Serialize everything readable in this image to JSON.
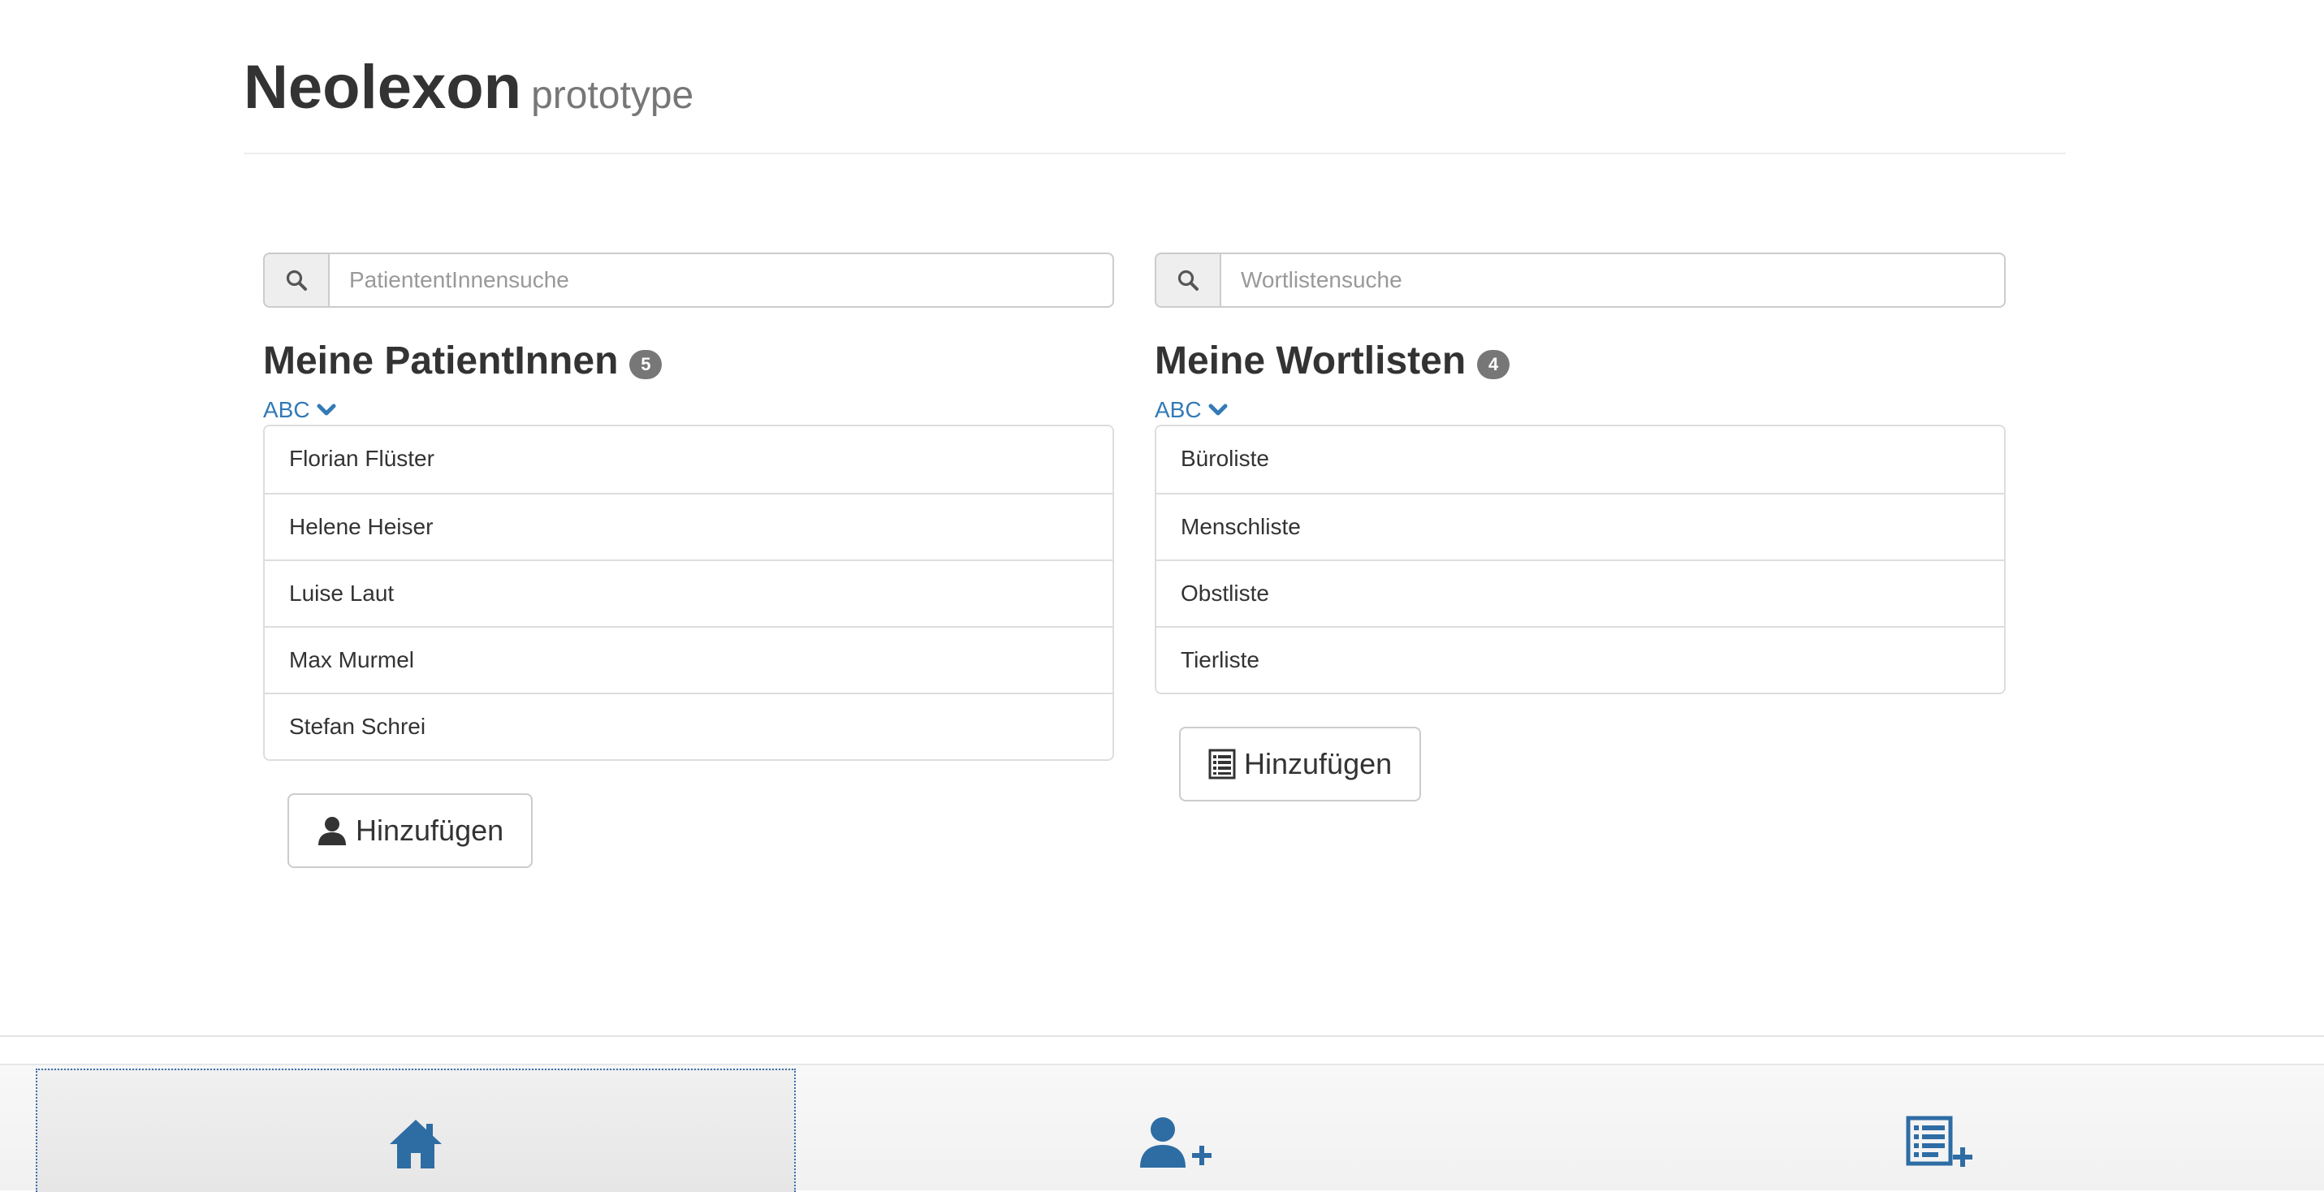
{
  "header": {
    "brand": "Neolexon",
    "subtitle": "prototype"
  },
  "patients": {
    "search_placeholder": "PatiententInnensuche",
    "title": "Meine PatientInnen",
    "count": "5",
    "sort_label": "ABC",
    "items": [
      {
        "label": "Florian Flüster"
      },
      {
        "label": "Helene Heiser"
      },
      {
        "label": "Luise Laut"
      },
      {
        "label": "Max Murmel"
      },
      {
        "label": "Stefan Schrei"
      }
    ],
    "add_label": "Hinzufügen"
  },
  "wordlists": {
    "search_placeholder": "Wortlistensuche",
    "title": "Meine Wortlisten",
    "count": "4",
    "sort_label": "ABC",
    "items": [
      {
        "label": "Büroliste"
      },
      {
        "label": "Menschliste"
      },
      {
        "label": "Obstliste"
      },
      {
        "label": "Tierliste"
      }
    ],
    "add_label": "Hinzufügen"
  },
  "bottom_nav": {
    "tabs": [
      {
        "icon": "home-icon",
        "active": true
      },
      {
        "icon": "add-user-icon",
        "active": false
      },
      {
        "icon": "add-list-icon",
        "active": false
      }
    ]
  },
  "colors": {
    "link": "#337ab7",
    "nav_icon": "#2e6ca4",
    "badge": "#777777",
    "active_tab_border": "#3a6fb0"
  }
}
